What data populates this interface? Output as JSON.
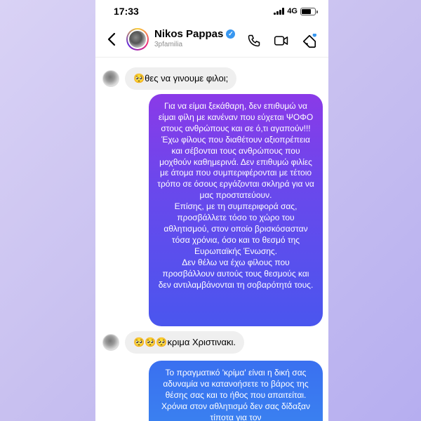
{
  "status": {
    "time": "17:33",
    "network": "4G"
  },
  "contact": {
    "name": "Nikos Pappas",
    "username": "3pfamilia"
  },
  "messages": {
    "incoming_1": "🥺θες να γινουμε φιλοι;",
    "outgoing_1": [
      "Για να είμαι ξεκάθαρη, δεν επιθυμώ να είμαι φίλη με κανέναν που εύχεται ΨΟΦΟ στους ανθρώπους και σε ό,τι αγαπούν!!!Έχω φίλους που διαθέτουν αξιοπρέπεια και σέβονται τους ανθρώπους που μοχθούν καθημερινά. Δεν επιθυμώ φιλίες με άτομα που συμπεριφέρονται με τέτοιο τρόπο σε όσους εργάζονται σκληρά για να μας προστατεύουν.",
      "Επίσης, με τη συμπεριφορά σας, προσβάλλετε τόσο το χώρο του αθλητισμού, στον οποίο βρισκόσασταν τόσα χρόνια, όσο και το θεσμό της Ευρωπαϊκής Ένωσης.",
      "Δεν θέλω να έχω φίλους που προσβάλλουν αυτούς τους θεσμούς και δεν αντιλαμβάνονται τη σοβαρότητά τους."
    ],
    "incoming_2": "🥺🥺🥺κριμα Χριστινακι.",
    "outgoing_2": "Το πραγματικό 'κρίμα' είναι η δική σας αδυναμία να κατανοήσετε το βάρος της θέσης σας και το ήθος που απαιτείται. Χρόνια στον αθλητισμό δεν σας δίδαξαν τίποτα για τον"
  },
  "colors": {
    "outgoing_gradient_top": "#8a3ae8",
    "outgoing_gradient_bottom": "#4a56ee",
    "verified": "#3897f0",
    "incoming_bubble": "#efefef"
  },
  "icons": [
    "back-arrow-icon",
    "verified-badge-icon",
    "phone-icon",
    "video-icon",
    "tag-icon"
  ]
}
